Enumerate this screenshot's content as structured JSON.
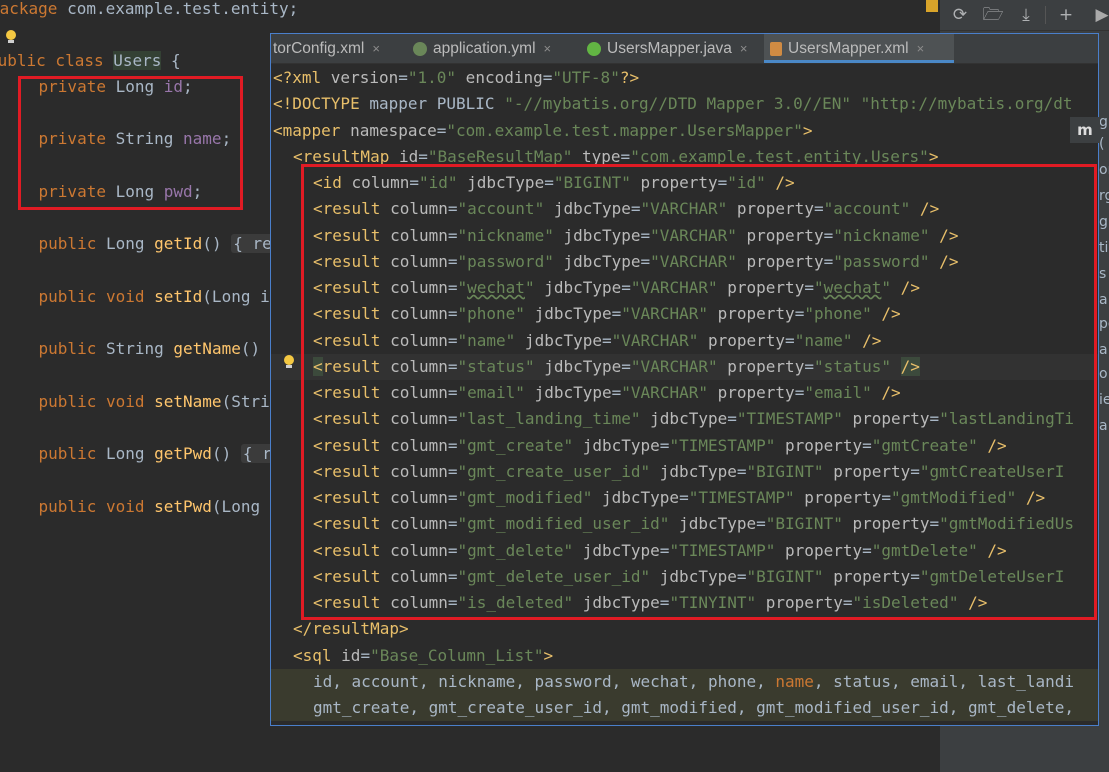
{
  "java_editor": {
    "lines": [
      {
        "parts": [
          [
            "kw",
            "package "
          ],
          [
            "pl",
            "com.example.test.entity;"
          ]
        ]
      },
      {
        "parts": [
          [
            "kw",
            "public class "
          ],
          [
            "clshl",
            "Users"
          ],
          [
            "pl",
            " {"
          ]
        ]
      },
      {
        "parts": [
          [
            "pl",
            "    "
          ],
          [
            "kw",
            "private "
          ],
          [
            "pl",
            "Long "
          ],
          [
            "fld",
            "id"
          ],
          [
            "pl",
            ";"
          ]
        ]
      },
      {
        "parts": [
          [
            "pl",
            "    "
          ],
          [
            "kw",
            "private "
          ],
          [
            "pl",
            "String "
          ],
          [
            "fld",
            "name"
          ],
          [
            "pl",
            ";"
          ]
        ]
      },
      {
        "parts": [
          [
            "pl",
            "    "
          ],
          [
            "kw",
            "private "
          ],
          [
            "pl",
            "Long "
          ],
          [
            "fld",
            "pwd"
          ],
          [
            "pl",
            ";"
          ]
        ]
      },
      {
        "parts": [
          [
            "pl",
            "    "
          ],
          [
            "kw",
            "public "
          ],
          [
            "pl",
            "Long "
          ],
          [
            "meth",
            "getId"
          ],
          [
            "pl",
            "() "
          ],
          [
            "fold",
            "{ re"
          ]
        ]
      },
      {
        "parts": [
          [
            "pl",
            "    "
          ],
          [
            "kw",
            "public void "
          ],
          [
            "meth",
            "setId"
          ],
          [
            "pl",
            "(Long i"
          ]
        ]
      },
      {
        "parts": [
          [
            "pl",
            "    "
          ],
          [
            "kw",
            "public "
          ],
          [
            "pl",
            "String "
          ],
          [
            "meth",
            "getName"
          ],
          [
            "pl",
            "()"
          ]
        ]
      },
      {
        "parts": [
          [
            "pl",
            "    "
          ],
          [
            "kw",
            "public void "
          ],
          [
            "meth",
            "setName"
          ],
          [
            "pl",
            "(Stri"
          ]
        ]
      },
      {
        "parts": [
          [
            "pl",
            "    "
          ],
          [
            "kw",
            "public "
          ],
          [
            "pl",
            "Long "
          ],
          [
            "meth",
            "getPwd"
          ],
          [
            "pl",
            "() "
          ],
          [
            "fold",
            "{ r"
          ]
        ]
      },
      {
        "parts": [
          [
            "pl",
            "    "
          ],
          [
            "kw",
            "public void "
          ],
          [
            "meth",
            "setPwd"
          ],
          [
            "pl",
            "(Long "
          ]
        ]
      }
    ]
  },
  "tabs": [
    {
      "label": "torConfig.xml",
      "icon": "xml-file-icon",
      "active": false
    },
    {
      "label": "application.yml",
      "icon": "yml-leaf-icon",
      "active": false
    },
    {
      "label": "UsersMapper.java",
      "icon": "java-interface-icon",
      "active": false
    },
    {
      "label": "UsersMapper.xml",
      "icon": "mybatis-xml-icon",
      "active": true
    }
  ],
  "tab_close_glyph": "×",
  "xml_lines": [
    {
      "indent": 0,
      "parts": [
        [
          "tag",
          "<?xml "
        ],
        [
          "attr",
          "version"
        ],
        [
          "pun",
          "="
        ],
        [
          "val",
          "\"1.0\""
        ],
        [
          "attr",
          " encoding"
        ],
        [
          "pun",
          "="
        ],
        [
          "val",
          "\"UTF-8\""
        ],
        [
          "tag",
          "?>"
        ]
      ]
    },
    {
      "indent": 0,
      "parts": [
        [
          "tag",
          "<!DOCTYPE "
        ],
        [
          "pun",
          "mapper PUBLIC "
        ],
        [
          "val",
          "\"-//mybatis.org//DTD Mapper 3.0//EN\""
        ],
        [
          "pun",
          " "
        ],
        [
          "val",
          "\"http://mybatis.org/dt"
        ]
      ]
    },
    {
      "indent": 0,
      "parts": [
        [
          "tag",
          "<mapper "
        ],
        [
          "attr",
          "namespace"
        ],
        [
          "pun",
          "="
        ],
        [
          "val",
          "\"com.example.test.mapper.UsersMapper\""
        ],
        [
          "tag",
          ">"
        ]
      ]
    },
    {
      "indent": 1,
      "parts": [
        [
          "tag",
          "<resultMap "
        ],
        [
          "attr",
          "id"
        ],
        [
          "pun",
          "="
        ],
        [
          "val",
          "\"BaseResultMap\""
        ],
        [
          "attr",
          " type"
        ],
        [
          "pun",
          "="
        ],
        [
          "val",
          "\"com.example.test.entity.Users\""
        ],
        [
          "tag",
          ">"
        ]
      ]
    },
    {
      "indent": 2,
      "parts": [
        [
          "tag",
          "<id "
        ],
        [
          "attr",
          "column"
        ],
        [
          "pun",
          "="
        ],
        [
          "val",
          "\"id\""
        ],
        [
          "attr",
          " jdbcType"
        ],
        [
          "pun",
          "="
        ],
        [
          "val",
          "\"BIGINT\""
        ],
        [
          "attr",
          " property"
        ],
        [
          "pun",
          "="
        ],
        [
          "val",
          "\"id\""
        ],
        [
          "tag",
          " />"
        ]
      ]
    },
    {
      "indent": 2,
      "parts": [
        [
          "tag",
          "<result "
        ],
        [
          "attr",
          "column"
        ],
        [
          "pun",
          "="
        ],
        [
          "val",
          "\"account\""
        ],
        [
          "attr",
          " jdbcType"
        ],
        [
          "pun",
          "="
        ],
        [
          "val",
          "\"VARCHAR\""
        ],
        [
          "attr",
          " property"
        ],
        [
          "pun",
          "="
        ],
        [
          "val",
          "\"account\""
        ],
        [
          "tag",
          " />"
        ]
      ]
    },
    {
      "indent": 2,
      "parts": [
        [
          "tag",
          "<result "
        ],
        [
          "attr",
          "column"
        ],
        [
          "pun",
          "="
        ],
        [
          "val",
          "\"nickname\""
        ],
        [
          "attr",
          " jdbcType"
        ],
        [
          "pun",
          "="
        ],
        [
          "val",
          "\"VARCHAR\""
        ],
        [
          "attr",
          " property"
        ],
        [
          "pun",
          "="
        ],
        [
          "val",
          "\"nickname\""
        ],
        [
          "tag",
          " />"
        ]
      ]
    },
    {
      "indent": 2,
      "parts": [
        [
          "tag",
          "<result "
        ],
        [
          "attr",
          "column"
        ],
        [
          "pun",
          "="
        ],
        [
          "val",
          "\"password\""
        ],
        [
          "attr",
          " jdbcType"
        ],
        [
          "pun",
          "="
        ],
        [
          "val",
          "\"VARCHAR\""
        ],
        [
          "attr",
          " property"
        ],
        [
          "pun",
          "="
        ],
        [
          "val",
          "\"password\""
        ],
        [
          "tag",
          " />"
        ]
      ]
    },
    {
      "indent": 2,
      "parts": [
        [
          "tag",
          "<result "
        ],
        [
          "attr",
          "column"
        ],
        [
          "pun",
          "="
        ],
        [
          "val",
          "\""
        ],
        [
          "valu",
          "wechat"
        ],
        [
          "val",
          "\""
        ],
        [
          "attr",
          " jdbcType"
        ],
        [
          "pun",
          "="
        ],
        [
          "val",
          "\"VARCHAR\""
        ],
        [
          "attr",
          " property"
        ],
        [
          "pun",
          "="
        ],
        [
          "val",
          "\""
        ],
        [
          "valu",
          "wechat"
        ],
        [
          "val",
          "\""
        ],
        [
          "tag",
          " />"
        ]
      ]
    },
    {
      "indent": 2,
      "parts": [
        [
          "tag",
          "<result "
        ],
        [
          "attr",
          "column"
        ],
        [
          "pun",
          "="
        ],
        [
          "val",
          "\"phone\""
        ],
        [
          "attr",
          " jdbcType"
        ],
        [
          "pun",
          "="
        ],
        [
          "val",
          "\"VARCHAR\""
        ],
        [
          "attr",
          " property"
        ],
        [
          "pun",
          "="
        ],
        [
          "val",
          "\"phone\""
        ],
        [
          "tag",
          " />"
        ]
      ]
    },
    {
      "indent": 2,
      "parts": [
        [
          "tag",
          "<result "
        ],
        [
          "attr",
          "column"
        ],
        [
          "pun",
          "="
        ],
        [
          "val",
          "\"name\""
        ],
        [
          "attr",
          " jdbcType"
        ],
        [
          "pun",
          "="
        ],
        [
          "val",
          "\"VARCHAR\""
        ],
        [
          "attr",
          " property"
        ],
        [
          "pun",
          "="
        ],
        [
          "val",
          "\"name\""
        ],
        [
          "tag",
          " />"
        ]
      ]
    },
    {
      "indent": 2,
      "caret": true,
      "parts": [
        [
          "tagp",
          "<"
        ],
        [
          "tag",
          "result "
        ],
        [
          "attr",
          "column"
        ],
        [
          "pun",
          "="
        ],
        [
          "val",
          "\"status\""
        ],
        [
          "attr",
          " jdbcType"
        ],
        [
          "pun",
          "="
        ],
        [
          "val",
          "\"VARCHAR\""
        ],
        [
          "attr",
          " property"
        ],
        [
          "pun",
          "="
        ],
        [
          "val",
          "\"status\""
        ],
        [
          "pun",
          " "
        ],
        [
          "tagp",
          "/>"
        ]
      ]
    },
    {
      "indent": 2,
      "parts": [
        [
          "tag",
          "<result "
        ],
        [
          "attr",
          "column"
        ],
        [
          "pun",
          "="
        ],
        [
          "val",
          "\"email\""
        ],
        [
          "attr",
          " jdbcType"
        ],
        [
          "pun",
          "="
        ],
        [
          "val",
          "\"VARCHAR\""
        ],
        [
          "attr",
          " property"
        ],
        [
          "pun",
          "="
        ],
        [
          "val",
          "\"email\""
        ],
        [
          "tag",
          " />"
        ]
      ]
    },
    {
      "indent": 2,
      "parts": [
        [
          "tag",
          "<result "
        ],
        [
          "attr",
          "column"
        ],
        [
          "pun",
          "="
        ],
        [
          "val",
          "\"last_landing_time\""
        ],
        [
          "attr",
          " jdbcType"
        ],
        [
          "pun",
          "="
        ],
        [
          "val",
          "\"TIMESTAMP\""
        ],
        [
          "attr",
          " property"
        ],
        [
          "pun",
          "="
        ],
        [
          "val",
          "\"lastLandingTi"
        ]
      ]
    },
    {
      "indent": 2,
      "parts": [
        [
          "tag",
          "<result "
        ],
        [
          "attr",
          "column"
        ],
        [
          "pun",
          "="
        ],
        [
          "val",
          "\"gmt_create\""
        ],
        [
          "attr",
          " jdbcType"
        ],
        [
          "pun",
          "="
        ],
        [
          "val",
          "\"TIMESTAMP\""
        ],
        [
          "attr",
          " property"
        ],
        [
          "pun",
          "="
        ],
        [
          "val",
          "\"gmtCreate\""
        ],
        [
          "tag",
          " />"
        ]
      ]
    },
    {
      "indent": 2,
      "parts": [
        [
          "tag",
          "<result "
        ],
        [
          "attr",
          "column"
        ],
        [
          "pun",
          "="
        ],
        [
          "val",
          "\"gmt_create_user_id\""
        ],
        [
          "attr",
          " jdbcType"
        ],
        [
          "pun",
          "="
        ],
        [
          "val",
          "\"BIGINT\""
        ],
        [
          "attr",
          " property"
        ],
        [
          "pun",
          "="
        ],
        [
          "val",
          "\"gmtCreateUserI"
        ]
      ]
    },
    {
      "indent": 2,
      "parts": [
        [
          "tag",
          "<result "
        ],
        [
          "attr",
          "column"
        ],
        [
          "pun",
          "="
        ],
        [
          "val",
          "\"gmt_modified\""
        ],
        [
          "attr",
          " jdbcType"
        ],
        [
          "pun",
          "="
        ],
        [
          "val",
          "\"TIMESTAMP\""
        ],
        [
          "attr",
          " property"
        ],
        [
          "pun",
          "="
        ],
        [
          "val",
          "\"gmtModified\""
        ],
        [
          "tag",
          " />"
        ]
      ]
    },
    {
      "indent": 2,
      "parts": [
        [
          "tag",
          "<result "
        ],
        [
          "attr",
          "column"
        ],
        [
          "pun",
          "="
        ],
        [
          "val",
          "\"gmt_modified_user_id\""
        ],
        [
          "attr",
          " jdbcType"
        ],
        [
          "pun",
          "="
        ],
        [
          "val",
          "\"BIGINT\""
        ],
        [
          "attr",
          " property"
        ],
        [
          "pun",
          "="
        ],
        [
          "val",
          "\"gmtModifiedUs"
        ]
      ]
    },
    {
      "indent": 2,
      "parts": [
        [
          "tag",
          "<result "
        ],
        [
          "attr",
          "column"
        ],
        [
          "pun",
          "="
        ],
        [
          "val",
          "\"gmt_delete\""
        ],
        [
          "attr",
          " jdbcType"
        ],
        [
          "pun",
          "="
        ],
        [
          "val",
          "\"TIMESTAMP\""
        ],
        [
          "attr",
          " property"
        ],
        [
          "pun",
          "="
        ],
        [
          "val",
          "\"gmtDelete\""
        ],
        [
          "tag",
          " />"
        ]
      ]
    },
    {
      "indent": 2,
      "parts": [
        [
          "tag",
          "<result "
        ],
        [
          "attr",
          "column"
        ],
        [
          "pun",
          "="
        ],
        [
          "val",
          "\"gmt_delete_user_id\""
        ],
        [
          "attr",
          " jdbcType"
        ],
        [
          "pun",
          "="
        ],
        [
          "val",
          "\"BIGINT\""
        ],
        [
          "attr",
          " property"
        ],
        [
          "pun",
          "="
        ],
        [
          "val",
          "\"gmtDeleteUserI"
        ]
      ]
    },
    {
      "indent": 2,
      "parts": [
        [
          "tag",
          "<result "
        ],
        [
          "attr",
          "column"
        ],
        [
          "pun",
          "="
        ],
        [
          "val",
          "\"is_deleted\""
        ],
        [
          "attr",
          " jdbcType"
        ],
        [
          "pun",
          "="
        ],
        [
          "val",
          "\"TINYINT\""
        ],
        [
          "attr",
          " property"
        ],
        [
          "pun",
          "="
        ],
        [
          "val",
          "\"isDeleted\""
        ],
        [
          "tag",
          " />"
        ]
      ]
    },
    {
      "indent": 1,
      "parts": [
        [
          "tag",
          "</resultMap>"
        ]
      ]
    },
    {
      "indent": 1,
      "parts": [
        [
          "tag",
          "<sql "
        ],
        [
          "attr",
          "id"
        ],
        [
          "pun",
          "="
        ],
        [
          "val",
          "\"Base_Column_List\""
        ],
        [
          "tag",
          ">"
        ]
      ]
    },
    {
      "indent": 2,
      "sql": true,
      "parts": [
        [
          "pun",
          "id, account, nickname, password, wechat, phone, "
        ],
        [
          "kw",
          "name"
        ],
        [
          "pun",
          ", status, email, last_landi"
        ]
      ]
    },
    {
      "indent": 2,
      "sql": true,
      "parts": [
        [
          "pun",
          "gmt_create, gmt_create_user_id, gmt_modified, gmt_modified_user_id, gmt_delete,"
        ]
      ]
    }
  ],
  "toolbar_icons": [
    "refresh-icon",
    "project-structure-icon",
    "download-icon",
    "add-icon",
    "run-icon"
  ],
  "edge_text": [
    "g",
    "(",
    "or",
    "rg",
    "g",
    "ti",
    "s",
    "a",
    "po",
    "a",
    "o",
    "ie",
    "a"
  ],
  "colors": {
    "accent": "#4a88c7",
    "highlight_box": "#e01b24"
  }
}
